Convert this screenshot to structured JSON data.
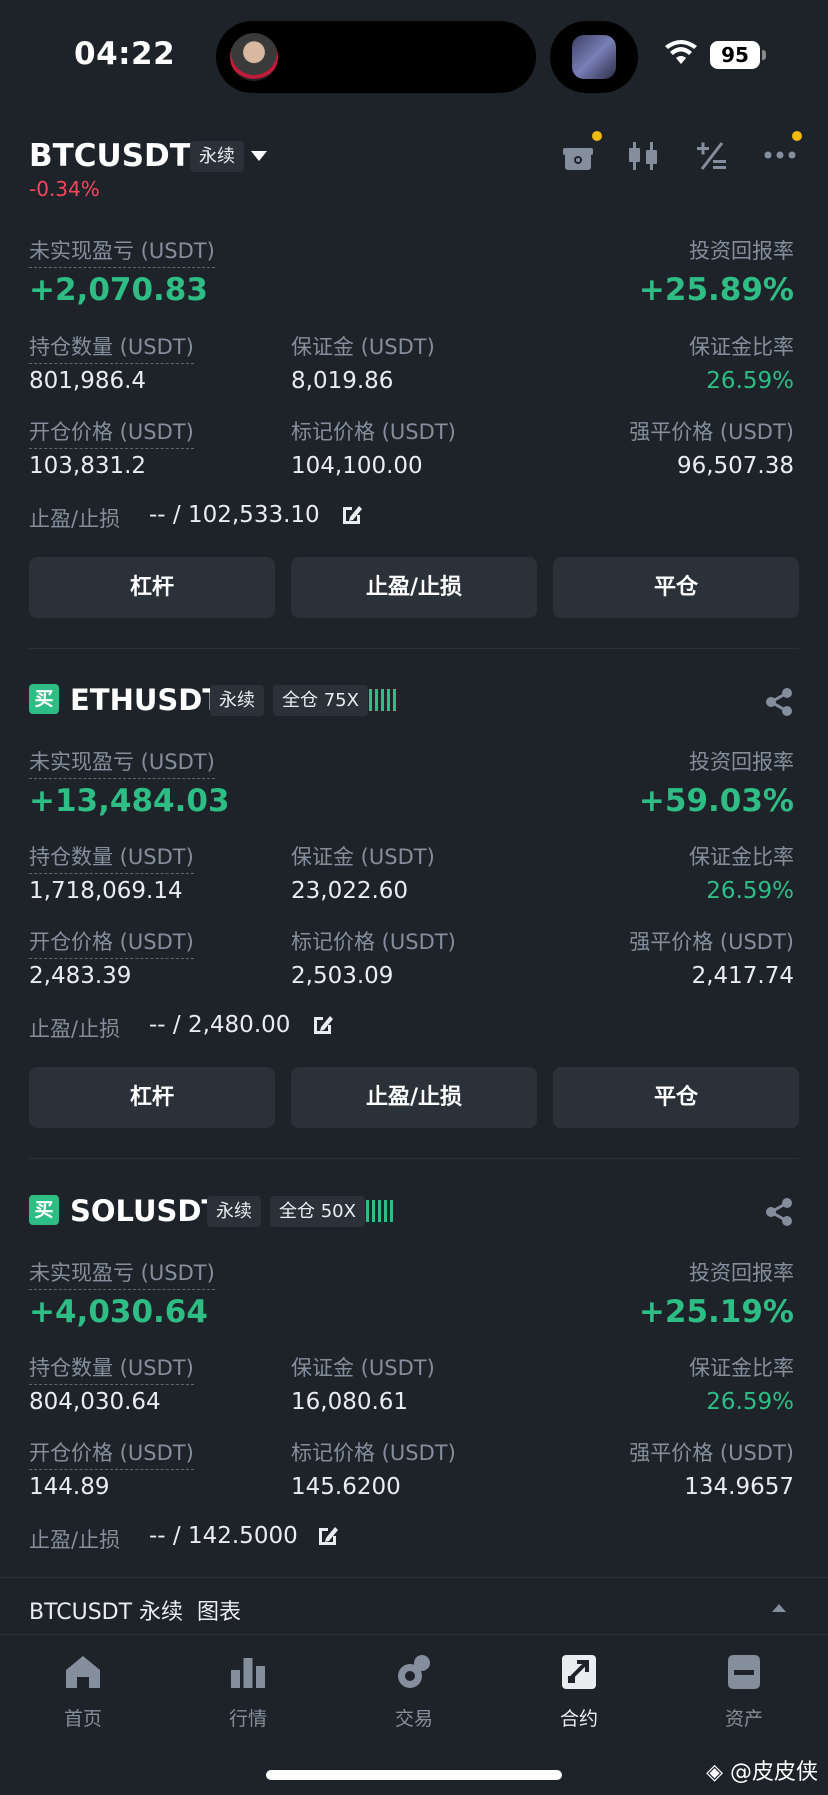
{
  "status_bar": {
    "time": "04:22",
    "battery": "95"
  },
  "header": {
    "symbol": "BTCUSDT",
    "contract_type": "永续",
    "change": "-0.34%",
    "change_color": "#f6465d"
  },
  "labels": {
    "unrealized_pnl": "未实现盈亏 (USDT)",
    "roe": "投资回报率",
    "size": "持仓数量 (USDT)",
    "margin": "保证金 (USDT)",
    "margin_ratio": "保证金比率",
    "entry_price": "开仓价格 (USDT)",
    "mark_price": "标记价格 (USDT)",
    "liq_price": "强平价格 (USDT)",
    "tpsl": "止盈/止损",
    "btn_leverage": "杠杆",
    "btn_tpsl": "止盈/止损",
    "btn_close": "平仓"
  },
  "positions": [
    {
      "unrealized_pnl": "+2,070.83",
      "roe": "+25.89%",
      "size": "801,986.4",
      "margin": "8,019.86",
      "margin_ratio": "26.59%",
      "entry_price": "103,831.2",
      "mark_price": "104,100.00",
      "liq_price": "96,507.38",
      "tpsl": "-- / 102,533.10"
    },
    {
      "side": "买",
      "symbol": "ETHUSDT",
      "contract_type": "永续",
      "margin_mode": "全仓 75X",
      "unrealized_pnl": "+13,484.03",
      "roe": "+59.03%",
      "size": "1,718,069.14",
      "margin": "23,022.60",
      "margin_ratio": "26.59%",
      "entry_price": "2,483.39",
      "mark_price": "2,503.09",
      "liq_price": "2,417.74",
      "tpsl": "-- / 2,480.00"
    },
    {
      "side": "买",
      "symbol": "SOLUSDT",
      "contract_type": "永续",
      "margin_mode": "全仓 50X",
      "unrealized_pnl": "+4,030.64",
      "roe": "+25.19%",
      "size": "804,030.64",
      "margin": "16,080.61",
      "margin_ratio": "26.59%",
      "entry_price": "144.89",
      "mark_price": "145.6200",
      "liq_price": "134.9657",
      "tpsl": "-- / 142.5000"
    }
  ],
  "chart_strip": {
    "label": "BTCUSDT 永续  图表"
  },
  "tabbar": {
    "items": [
      {
        "label": "首页",
        "icon": "home-icon"
      },
      {
        "label": "行情",
        "icon": "market-icon"
      },
      {
        "label": "交易",
        "icon": "trade-icon"
      },
      {
        "label": "合约",
        "icon": "futures-icon",
        "active": true
      },
      {
        "label": "资产",
        "icon": "wallet-icon"
      }
    ]
  },
  "watermark": "@皮皮侠",
  "colors": {
    "profit": "#2ebd85",
    "loss": "#f6465d",
    "accent": "#f0b90b",
    "background": "#1e2329"
  }
}
